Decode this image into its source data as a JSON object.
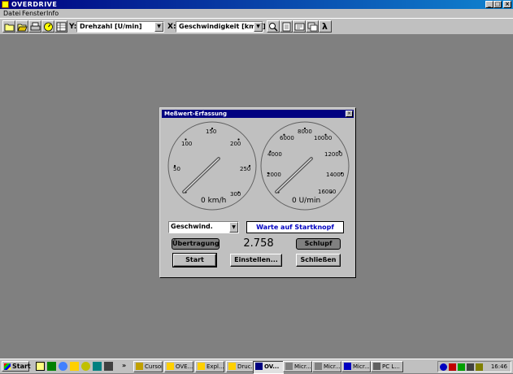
{
  "window": {
    "title": "OVERDRIVE",
    "minimize": "_",
    "maximize": "□",
    "close": "×"
  },
  "menu": [
    "Datei",
    "Fenster",
    "Info"
  ],
  "toolbar": {
    "y_label": "Y:",
    "y_value": "Drehzahl [U/min]",
    "x_label": "X:",
    "x_value": "Geschwindigkeit [km/h]",
    "lambda": "λ",
    "dropdown_arrow": "▼"
  },
  "dialog": {
    "title": "Meßwert-Erfassung",
    "close": "×",
    "speed_gauge": {
      "ticks": [
        "50",
        "100",
        "150",
        "200",
        "250",
        "300"
      ],
      "value": 0,
      "readout": "0 km/h"
    },
    "rpm_gauge": {
      "ticks": [
        "2000",
        "4000",
        "6000",
        "8000",
        "10000",
        "12000",
        "14000",
        "16000"
      ],
      "value": 0,
      "readout": "0 U/min"
    },
    "signal_select": "Geschwind.",
    "status": "Warte auf Startknopf",
    "indicator_left": "Übertragung",
    "indicator_right": "Schlupf",
    "value": "2.758",
    "buttons": {
      "start": "Start",
      "settings": "Einstellen...",
      "close": "Schließen"
    }
  },
  "taskbar": {
    "start": "Start",
    "more": "»",
    "tasks": [
      "Cursor",
      "OVE...",
      "Expl...",
      "Druc...",
      "OV...",
      "Micr...",
      "Micr...",
      "Micr...",
      "PC L..."
    ],
    "clock": "16:46"
  }
}
